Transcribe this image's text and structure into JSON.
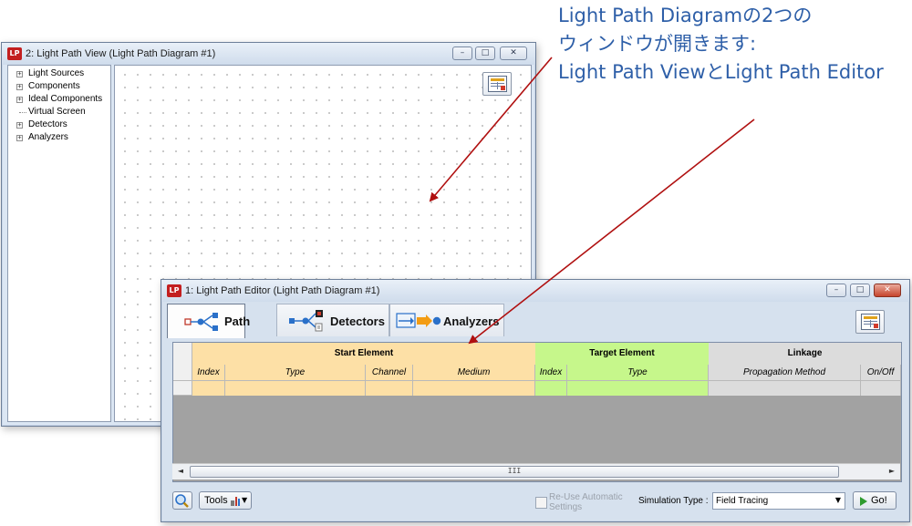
{
  "annotation": {
    "line1": "Light Path Diagramの2つの",
    "line2": "ウィンドウが開きます:",
    "line3": "Light Path ViewとLight Path Editor",
    "color": "#2e5fa8",
    "arrow_color": "#b01010"
  },
  "view_window": {
    "icon_label": "LP",
    "title": "2: Light Path View (Light Path Diagram #1)",
    "tree": [
      {
        "label": "Light Sources",
        "expandable": true
      },
      {
        "label": "Components",
        "expandable": true
      },
      {
        "label": "Ideal Components",
        "expandable": true
      },
      {
        "label": "Virtual Screen",
        "expandable": false
      },
      {
        "label": "Detectors",
        "expandable": true
      },
      {
        "label": "Analyzers",
        "expandable": true
      }
    ],
    "expander_glyph": "+",
    "buttons": {
      "minimize": "–",
      "maximize": "□",
      "close": "✕"
    }
  },
  "editor_window": {
    "icon_label": "LP",
    "title": "1: Light Path Editor (Light Path Diagram #1)",
    "tabs": [
      {
        "label": "Path",
        "active": true
      },
      {
        "label": "Detectors",
        "active": false
      },
      {
        "label": "Analyzers",
        "active": false
      }
    ],
    "grid": {
      "groups": [
        {
          "label": "Start Element",
          "color": "#fde0a6"
        },
        {
          "label": "Target Element",
          "color": "#c6f78b"
        },
        {
          "label": "Linkage",
          "color": "#dcdcdc"
        }
      ],
      "columns": [
        "Index",
        "Type",
        "Channel",
        "Medium",
        "Index",
        "Type",
        "Propagation Method",
        "On/Off"
      ],
      "rows": [
        [
          "",
          "",
          "",
          "",
          "",
          "",
          "",
          ""
        ]
      ]
    },
    "scrollbar": {
      "left_arrow": "◄",
      "right_arrow": "►",
      "grip": "III"
    },
    "bottom": {
      "tools_label": "Tools",
      "reuse_label_line1": "Re-Use Automatic",
      "reuse_label_line2": "Settings",
      "reuse_checked": false,
      "sim_type_label": "Simulation Type :",
      "sim_type_value": "Field Tracing",
      "go_label": "Go!"
    },
    "buttons": {
      "minimize": "–",
      "maximize": "□",
      "close": "✕"
    }
  }
}
